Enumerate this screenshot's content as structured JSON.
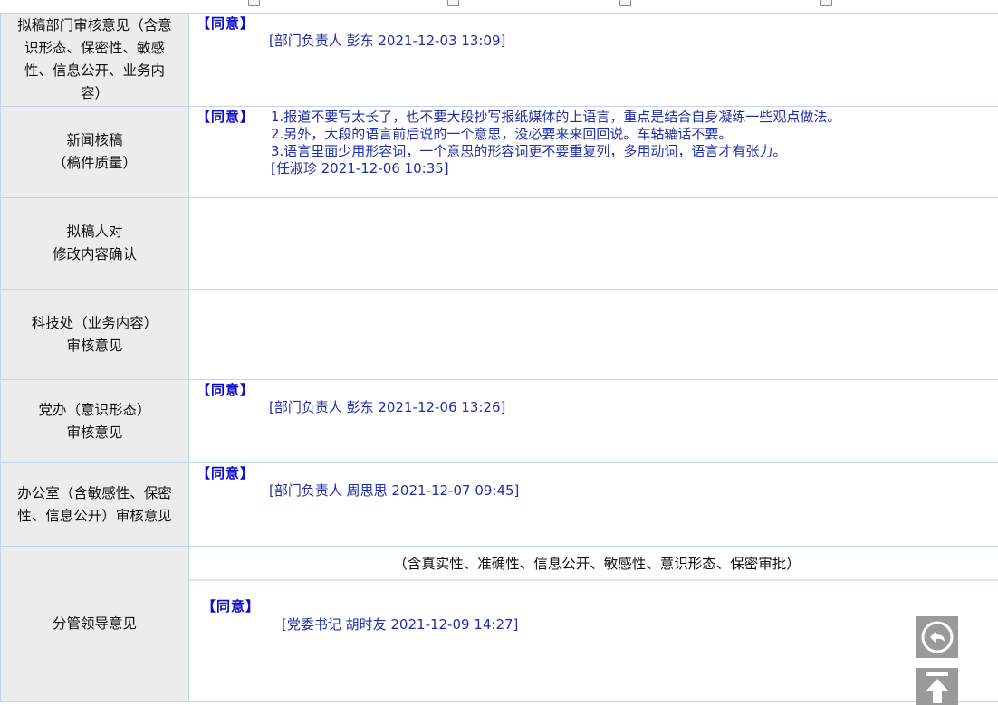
{
  "rows": {
    "dept_review": {
      "label_line1": "拟稿部门审核意见（含意",
      "label_line2": "识形态、保密性、敏感",
      "label_line3": "性、信息公开、业务内",
      "label_line4": "容）",
      "agree": "【同意】",
      "signature": "[部门负责人 彭东 2021-12-03 13:09]"
    },
    "news_review": {
      "label_line1": "新闻核稿",
      "label_line2": "（稿件质量）",
      "agree": "【同意】",
      "notes": [
        " 1.报道不要写太长了，也不要大段抄写报纸媒体的上语言，重点是结合自身凝练一些观点做法。",
        "2.另外，大段的语言前后说的一个意思，没必要来来回回说。车轱辘话不要。",
        "3.语言里面少用形容词，一个意思的形容词更不要重复列，多用动词，语言才有张力。",
        "[任淑珍 2021-12-06 10:35]"
      ]
    },
    "drafter_confirm": {
      "label_line1": "拟稿人对",
      "label_line2": "修改内容确认"
    },
    "tech_review": {
      "label_line1": "科技处（业务内容）",
      "label_line2": "审核意见"
    },
    "party_office": {
      "label_line1": "党办（意识形态）",
      "label_line2": "审核意见",
      "agree": "【同意】",
      "signature": "[部门负责人 彭东 2021-12-06 13:26]"
    },
    "general_office": {
      "label_line1": "办公室（含敏感性、保密",
      "label_line2": "性、信息公开）审核意见",
      "agree": "【同意】",
      "signature": "[部门负责人 周思思 2021-12-07 09:45]"
    },
    "leader_review": {
      "label": "分管领导意见",
      "scope": "（含真实性、准确性、信息公开、敏感性、意识形态、保密审批）",
      "agree": "【同意】",
      "signature": "[党委书记 胡时友 2021-12-09 14:27]"
    }
  },
  "floating_buttons": {
    "back_icon": "reply-arrow-icon",
    "top_icon": "back-to-top-icon",
    "color": "#9a9a9a"
  }
}
